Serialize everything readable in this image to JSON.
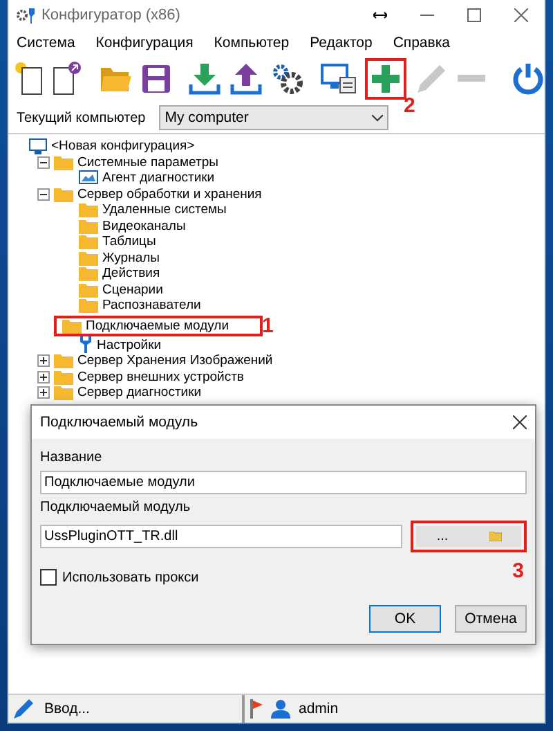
{
  "window": {
    "title": "Конфигуратор (x86)"
  },
  "menu": [
    "Система",
    "Конфигурация",
    "Компьютер",
    "Редактор",
    "Справка"
  ],
  "toolbar": [
    {
      "kind": "new"
    },
    {
      "kind": "new-linked"
    },
    {
      "kind": "open"
    },
    {
      "kind": "save"
    },
    {
      "kind": "download"
    },
    {
      "kind": "upload"
    },
    {
      "kind": "gears"
    },
    {
      "kind": "monitor"
    },
    {
      "kind": "add",
      "annotation": "2"
    },
    {
      "kind": "edit"
    },
    {
      "kind": "remove"
    },
    {
      "kind": "power"
    }
  ],
  "computer": {
    "label": "Текущий компьютер",
    "value": "My computer"
  },
  "tree": [
    {
      "label": "<Новая конфигурация>",
      "kind": "computer",
      "children": [
        {
          "label": "Системные параметры",
          "expanded": true,
          "children": [
            {
              "label": "Агент диагностики",
              "kind": "agent"
            }
          ]
        },
        {
          "label": "Сервер обработки и хранения",
          "expanded": true,
          "children": [
            {
              "label": "Удаленные системы"
            },
            {
              "label": "Видеоканалы"
            },
            {
              "label": "Таблицы"
            },
            {
              "label": "Журналы"
            },
            {
              "label": "Действия"
            },
            {
              "label": "Сценарии"
            },
            {
              "label": "Распознаватели"
            },
            {
              "label": "Подключаемые модули",
              "annotation": "1"
            },
            {
              "label": "Настройки",
              "kind": "key"
            }
          ]
        },
        {
          "label": "Сервер Хранения Изображений",
          "expanded": false
        },
        {
          "label": "Сервер внешних устройств",
          "expanded": false
        },
        {
          "label": "Сервер диагностики",
          "expanded": false
        }
      ]
    }
  ],
  "dialog": {
    "title": "Подключаемый модуль",
    "name_label": "Название",
    "name_value": "Подключаемые модули",
    "module_label": "Подключаемый модуль",
    "module_value": "UssPluginOTT_TR.dll",
    "browse_button": "...",
    "browse_annotation": "3",
    "proxy": {
      "label": "Использовать прокси",
      "checked": false
    },
    "buttons": [
      "OK",
      "Отмена"
    ]
  },
  "status_bar": {
    "input": "Ввод...",
    "user": "admin"
  }
}
